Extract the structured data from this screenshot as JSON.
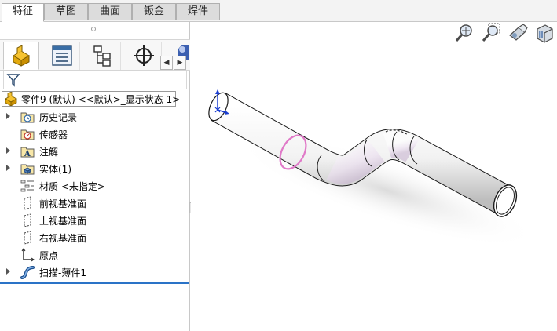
{
  "tabs": [
    {
      "label": "特征",
      "active": true
    },
    {
      "label": "草图",
      "active": false
    },
    {
      "label": "曲面",
      "active": false
    },
    {
      "label": "钣金",
      "active": false
    },
    {
      "label": "焊件",
      "active": false
    }
  ],
  "panel_tabs": [
    "featuremanager-icon",
    "propertymanager-icon",
    "configurationmanager-icon",
    "dimxpert-icon",
    "display-manager-icon"
  ],
  "root": {
    "label": "零件9 (默认) <<默认>_显示状态 1>"
  },
  "tree": [
    {
      "label": "历史记录",
      "icon": "history-icon",
      "expandable": true
    },
    {
      "label": "传感器",
      "icon": "sensor-icon",
      "expandable": false
    },
    {
      "label": "注解",
      "icon": "annotation-icon",
      "expandable": true
    },
    {
      "label": "实体(1)",
      "icon": "solid-body-icon",
      "expandable": true
    },
    {
      "label": "材质 <未指定>",
      "icon": "material-icon",
      "expandable": false
    },
    {
      "label": "前视基准面",
      "icon": "plane-icon",
      "expandable": false
    },
    {
      "label": "上视基准面",
      "icon": "plane-icon",
      "expandable": false
    },
    {
      "label": "右视基准面",
      "icon": "plane-icon",
      "expandable": false
    },
    {
      "label": "原点",
      "icon": "origin-icon",
      "expandable": false
    },
    {
      "label": "扫描-薄件1",
      "icon": "sweep-icon",
      "expandable": true
    }
  ],
  "view_tools": [
    "zoom-to-fit-icon",
    "zoom-to-area-icon",
    "previous-view-icon",
    "section-view-icon"
  ],
  "colors": {
    "accent": "#2a73c7",
    "profile": "#e07ac8"
  }
}
